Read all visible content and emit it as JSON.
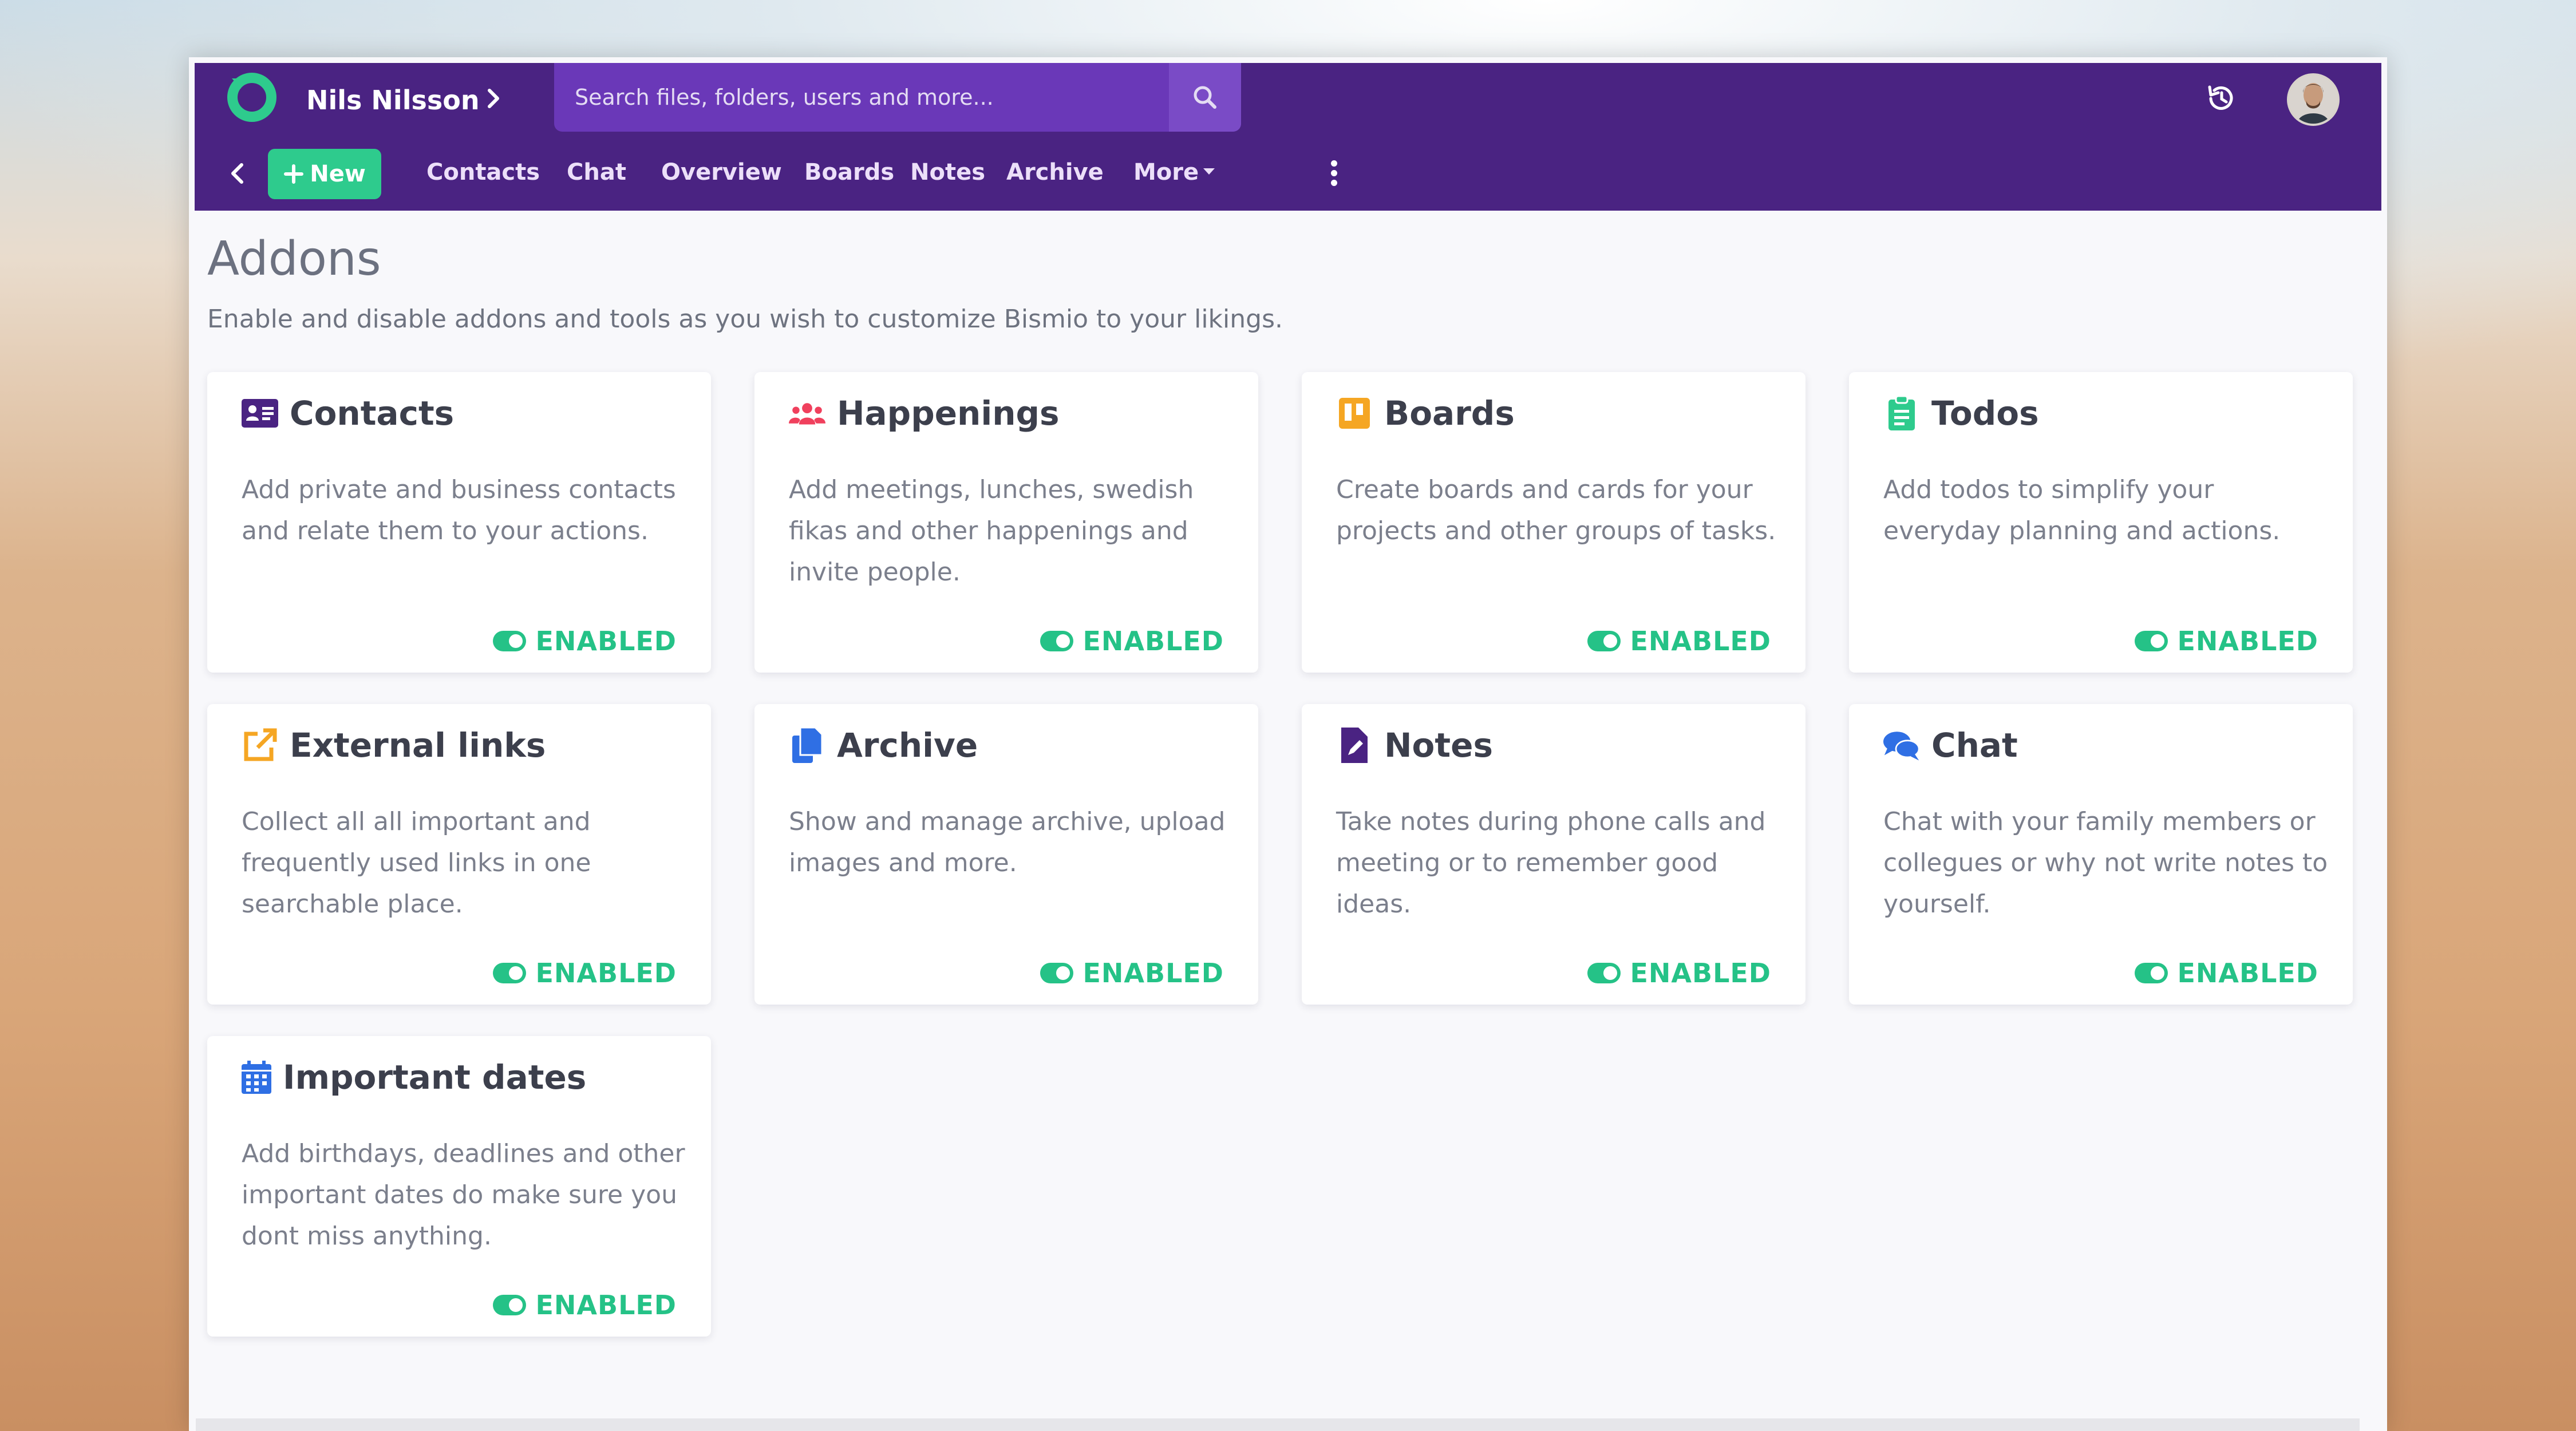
{
  "header": {
    "user_name": "Nils Nilsson",
    "search_placeholder": "Search files, folders, users and more...",
    "new_label": "New",
    "nav": [
      "Contacts",
      "Chat",
      "Overview",
      "Boards",
      "Notes",
      "Archive",
      "More"
    ]
  },
  "page": {
    "title": "Addons",
    "subtitle": "Enable and disable addons and tools as you wish to customize Bismio to your likings."
  },
  "addons": [
    {
      "title": "Contacts",
      "desc": "Add private and business contacts and relate them to your actions.",
      "status": "ENABLED",
      "icon": "contact-card-icon",
      "color": "#4a2382"
    },
    {
      "title": "Happenings",
      "desc": "Add meetings, lunches, swedish fikas and other happenings and invite people.",
      "status": "ENABLED",
      "icon": "users-icon",
      "color": "#f0405d"
    },
    {
      "title": "Boards",
      "desc": "Create boards and cards for your projects and other groups of tasks.",
      "status": "ENABLED",
      "icon": "board-icon",
      "color": "#f5a623"
    },
    {
      "title": "Todos",
      "desc": "Add todos to simplify your everyday planning and actions.",
      "status": "ENABLED",
      "icon": "clipboard-icon",
      "color": "#2ecb8d"
    },
    {
      "title": "External links",
      "desc": "Collect all all important and frequently used links in one searchable place.",
      "status": "ENABLED",
      "icon": "external-link-icon",
      "color": "#f5a623"
    },
    {
      "title": "Archive",
      "desc": "Show and manage archive, upload images and more.",
      "status": "ENABLED",
      "icon": "copy-icon",
      "color": "#2f6fe4"
    },
    {
      "title": "Notes",
      "desc": "Take notes during phone calls and meeting or to remember good ideas.",
      "status": "ENABLED",
      "icon": "note-file-icon",
      "color": "#4a2382"
    },
    {
      "title": "Chat",
      "desc": "Chat with your family members or collegues or why not write notes to yourself.",
      "status": "ENABLED",
      "icon": "chat-bubbles-icon",
      "color": "#2f6fe4"
    },
    {
      "title": "Important dates",
      "desc": "Add birthdays, deadlines and other important dates do make sure you dont miss anything.",
      "status": "ENABLED",
      "icon": "calendar-icon",
      "color": "#2f6fe4"
    }
  ]
}
